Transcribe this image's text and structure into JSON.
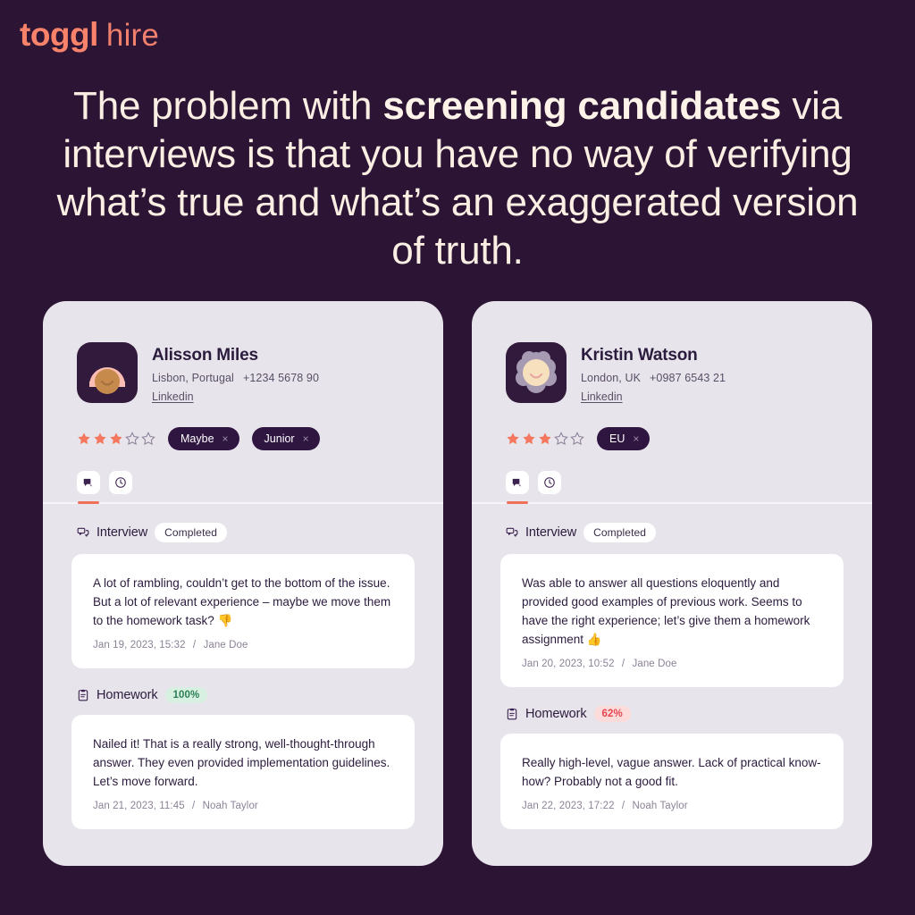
{
  "brand": {
    "name_primary": "toggl",
    "name_secondary": "hire",
    "accent": "#F9836A"
  },
  "headline": {
    "part1": "The problem with ",
    "emphasis": "screening candidates",
    "part2": " via interviews is that you have no way of verifying what’s true and what’s an exaggerated version of truth."
  },
  "colors": {
    "background": "#2C1435",
    "card_background": "#E7E5EB",
    "accent_coral": "#F1705A",
    "tag_background": "#2E1640",
    "pass_green": "#2B7F57",
    "fail_red": "#E8454F"
  },
  "cards": [
    {
      "candidate": {
        "name": "Alisson Miles",
        "location": "Lisbon, Portugal",
        "phone": "+1234 5678 90",
        "link_label": "Linkedin",
        "rating": 3,
        "rating_max": 5,
        "tags": [
          {
            "label": "Maybe",
            "remove": "×"
          },
          {
            "label": "Junior",
            "remove": "×"
          }
        ]
      },
      "tabs": [
        {
          "icon": "comment-icon",
          "active": true
        },
        {
          "icon": "clock-icon",
          "active": false
        }
      ],
      "sections": [
        {
          "icon": "chat-bubbles-icon",
          "title": "Interview",
          "badge": {
            "text": "Completed",
            "style": "white"
          },
          "note": {
            "body": "A lot of rambling, couldn’t get to the bottom of the issue. But a lot of relevant experience – maybe we move them to the homework task? 👎",
            "date": "Jan 19, 2023, 15:32",
            "separator": "/",
            "author": "Jane Doe"
          }
        },
        {
          "icon": "clipboard-icon",
          "title": "Homework",
          "badge": {
            "text": "100%",
            "style": "green"
          },
          "note": {
            "body": "Nailed it! That is a really strong, well-thought-through answer. They even provided implementation guidelines. Let’s move forward.",
            "date": "Jan 21, 2023, 11:45",
            "separator": "/",
            "author": "Noah Taylor"
          }
        }
      ]
    },
    {
      "candidate": {
        "name": "Kristin Watson",
        "location": "London, UK",
        "phone": "+0987 6543 21",
        "link_label": "Linkedin",
        "rating": 3,
        "rating_max": 5,
        "tags": [
          {
            "label": "EU",
            "remove": "×"
          }
        ]
      },
      "tabs": [
        {
          "icon": "comment-icon",
          "active": true
        },
        {
          "icon": "clock-icon",
          "active": false
        }
      ],
      "sections": [
        {
          "icon": "chat-bubbles-icon",
          "title": "Interview",
          "badge": {
            "text": "Completed",
            "style": "white"
          },
          "note": {
            "body": "Was able to answer all questions eloquently and provided good examples of previous work. Seems to have the right experience; let’s give them a homework assignment 👍",
            "date": "Jan 20, 2023, 10:52",
            "separator": "/",
            "author": "Jane Doe"
          }
        },
        {
          "icon": "clipboard-icon",
          "title": "Homework",
          "badge": {
            "text": "62%",
            "style": "red"
          },
          "note": {
            "body": "Really high-level, vague answer. Lack of practical know-how? Probably not a good fit.",
            "date": "Jan 22, 2023, 17:22",
            "separator": "/",
            "author": "Noah Taylor"
          }
        }
      ]
    }
  ]
}
